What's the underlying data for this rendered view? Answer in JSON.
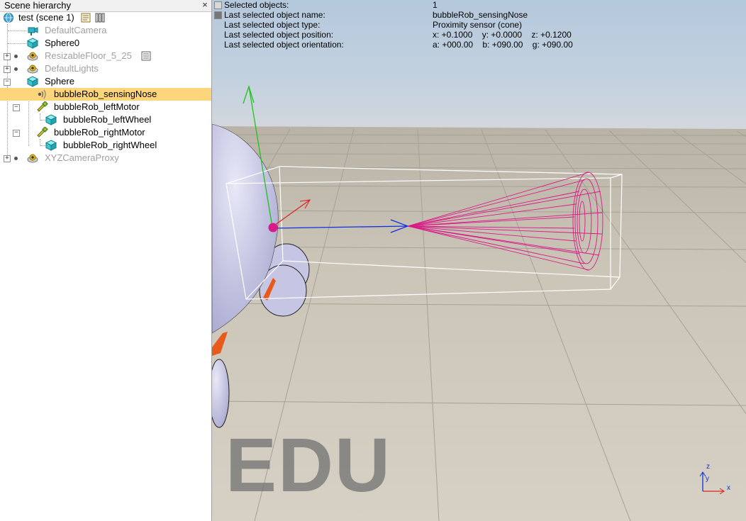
{
  "hierarchy": {
    "title": "Scene hierarchy",
    "close_glyph": "×",
    "root_label": "test (scene 1)",
    "items": [
      {
        "label": "DefaultCamera"
      },
      {
        "label": "Sphere0"
      },
      {
        "label": "ResizableFloor_5_25"
      },
      {
        "label": "DefaultLights"
      },
      {
        "label": "Sphere"
      },
      {
        "label": "bubbleRob_sensingNose"
      },
      {
        "label": "bubbleRob_leftMotor"
      },
      {
        "label": "bubbleRob_leftWheel"
      },
      {
        "label": "bubbleRob_rightMotor"
      },
      {
        "label": "bubbleRob_rightWheel"
      },
      {
        "label": "XYZCameraProxy"
      }
    ]
  },
  "info": {
    "rows": [
      {
        "label": "Selected objects:",
        "value": "1"
      },
      {
        "label": "Last selected object name:",
        "value": "bubbleRob_sensingNose"
      },
      {
        "label": "Last selected object type:",
        "value": "Proximity sensor (cone)"
      },
      {
        "label": "Last selected object position:",
        "value": "x: +0.1000    y: +0.0000    z: +0.1200"
      },
      {
        "label": "Last selected object orientation:",
        "value": "a: +000.00    b: +090.00    g: +090.00"
      }
    ]
  },
  "watermark": "EDU",
  "axes": {
    "x": "x",
    "y": "y",
    "z": "z"
  },
  "colors": {
    "selection": "#fdd57b",
    "sensor": "#d81b87",
    "axis_x": "#e02020",
    "axis_y": "#20c020",
    "axis_z": "#1030e0",
    "robot_body": "#c4c4e4",
    "robot_accent": "#e85a1a"
  }
}
